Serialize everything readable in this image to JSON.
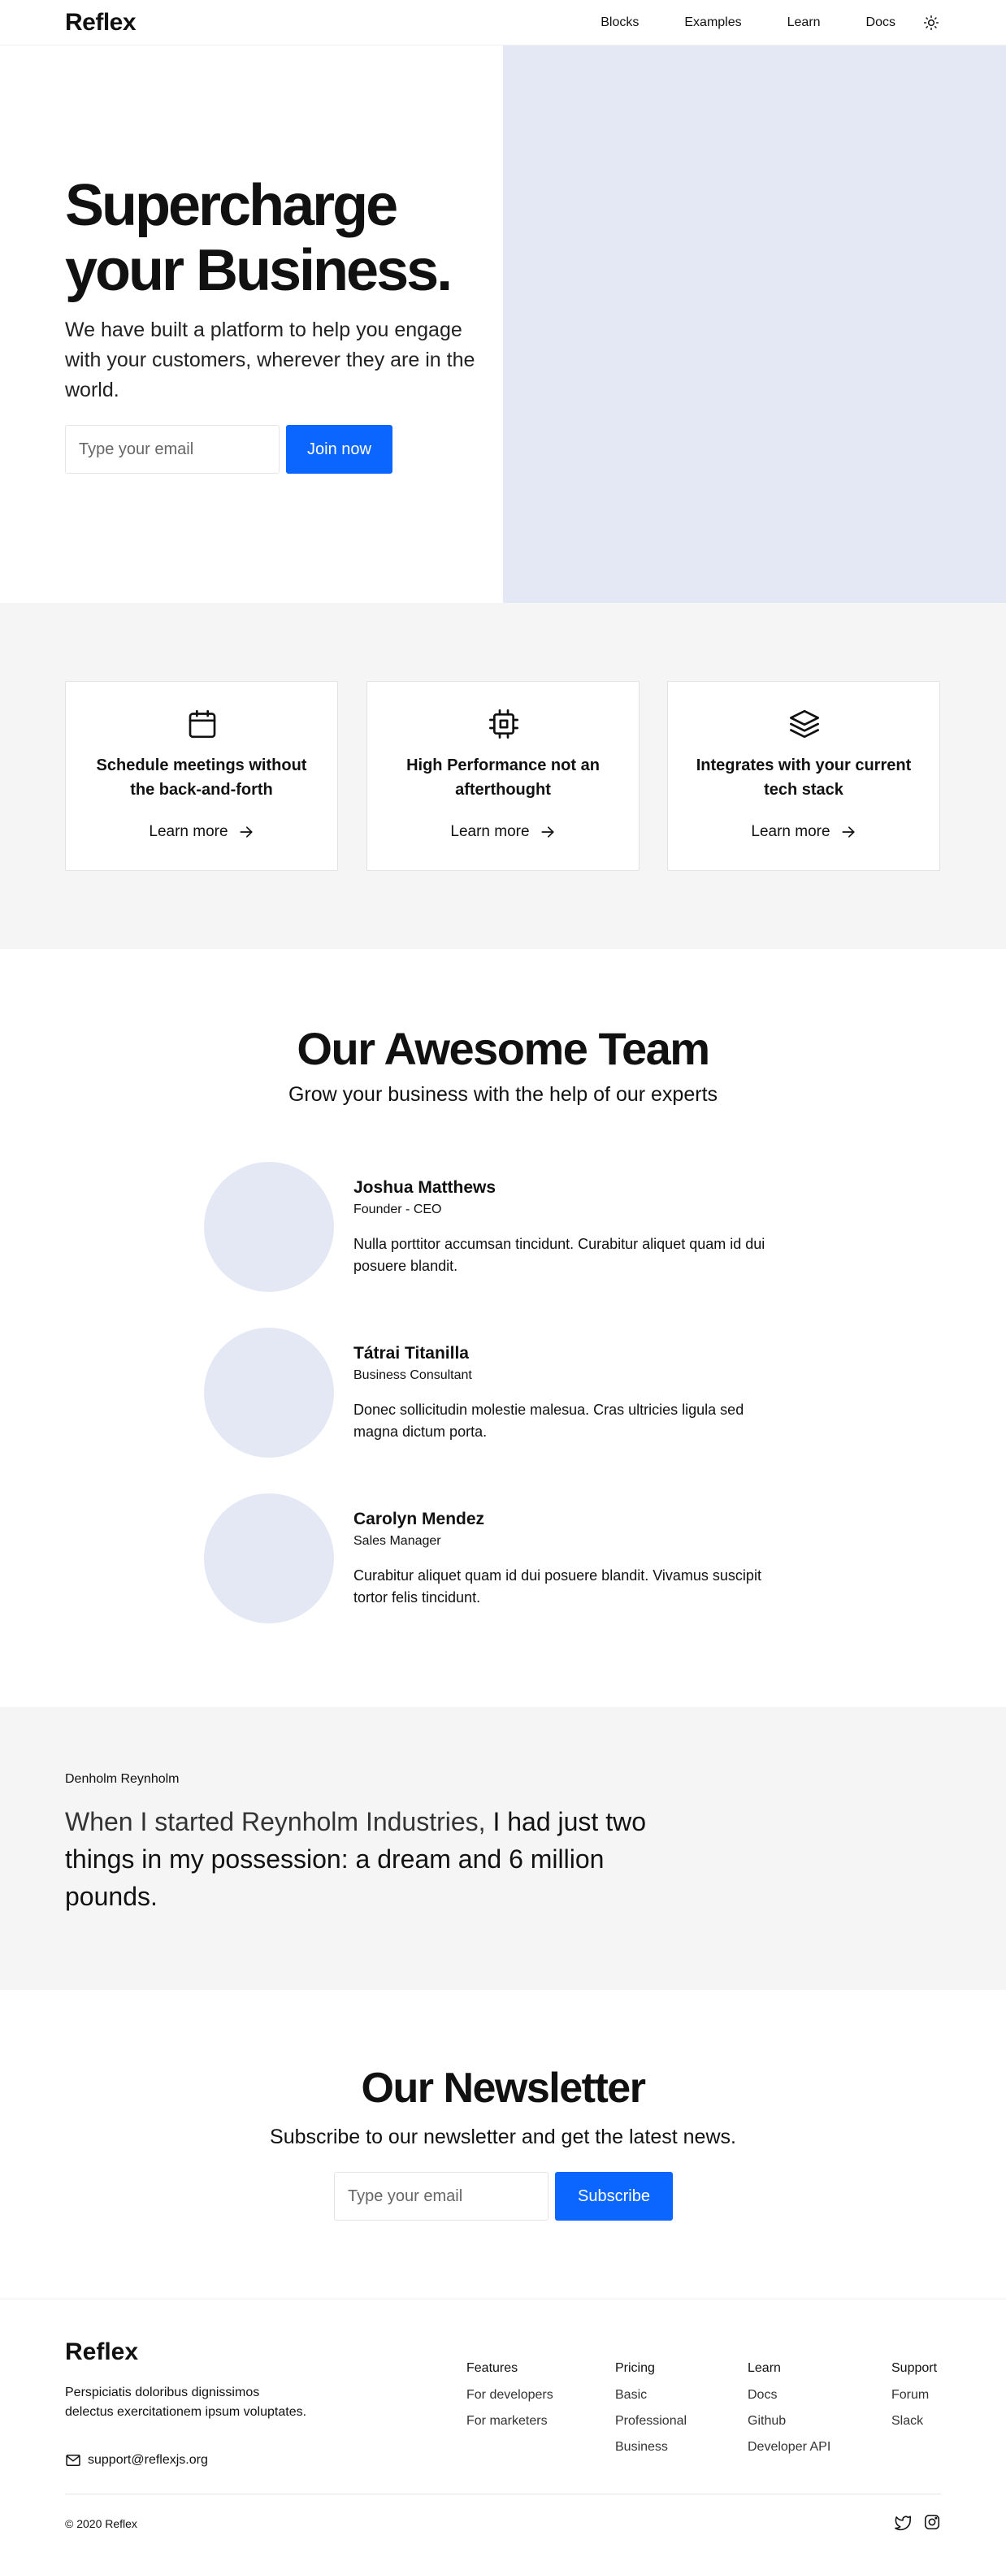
{
  "nav": {
    "logo": "Reflex",
    "links": [
      "Blocks",
      "Examples",
      "Learn",
      "Docs"
    ],
    "theme_icon": "sun-icon"
  },
  "hero": {
    "title_line1": "Supercharge",
    "title_line2": "your Business.",
    "subtitle": "We have built a platform to help you engage with your customers, wherever they are in the world.",
    "email_placeholder": "Type your email",
    "button_label": "Join now"
  },
  "features": [
    {
      "icon": "calendar-icon",
      "title": "Schedule meetings without the back-and-forth",
      "link": "Learn more"
    },
    {
      "icon": "cpu-icon",
      "title": "High Performance not an afterthought",
      "link": "Learn more"
    },
    {
      "icon": "layers-icon",
      "title": "Integrates with your current tech stack",
      "link": "Learn more"
    }
  ],
  "team": {
    "title": "Our Awesome Team",
    "subtitle": "Grow your business with the help of our experts",
    "members": [
      {
        "name": "Joshua Matthews",
        "role": "Founder - CEO",
        "bio": "Nulla porttitor accumsan tincidunt. Curabitur aliquet quam id dui posuere blandit."
      },
      {
        "name": "Tátrai Titanilla",
        "role": "Business Consultant",
        "bio": "Donec sollicitudin molestie malesua. Cras ultricies ligula sed magna dictum porta."
      },
      {
        "name": "Carolyn Mendez",
        "role": "Sales Manager",
        "bio": "Curabitur aliquet quam id dui posuere blandit. Vivamus suscipit tortor felis tincidunt."
      }
    ]
  },
  "testimonial": {
    "author": "Denholm Reynholm",
    "quote_light": "When I started Reynholm Industries,",
    "quote_bold": "I had just two things in my possession: a dream and 6 million pounds."
  },
  "newsletter": {
    "title": "Our Newsletter",
    "subtitle": "Subscribe to our newsletter and get the latest news.",
    "email_placeholder": "Type your email",
    "button_label": "Subscribe"
  },
  "footer": {
    "logo": "Reflex",
    "description": "Perspiciatis doloribus dignissimos delectus exercitationem ipsum voluptates.",
    "email": "support@reflexjs.org",
    "columns": [
      {
        "title": "Features",
        "items": [
          "For developers",
          "For marketers"
        ]
      },
      {
        "title": "Pricing",
        "items": [
          "Basic",
          "Professional",
          "Business"
        ]
      },
      {
        "title": "Learn",
        "items": [
          "Docs",
          "Github",
          "Developer API"
        ]
      },
      {
        "title": "Support",
        "items": [
          "Forum",
          "Slack"
        ]
      }
    ],
    "copyright": "© 2020 Reflex",
    "social_icons": [
      "twitter-icon",
      "instagram-icon"
    ]
  },
  "colors": {
    "accent": "#0a66ff",
    "placeholder_fill": "#e3e8f4",
    "section_gray": "#f5f5f5"
  }
}
